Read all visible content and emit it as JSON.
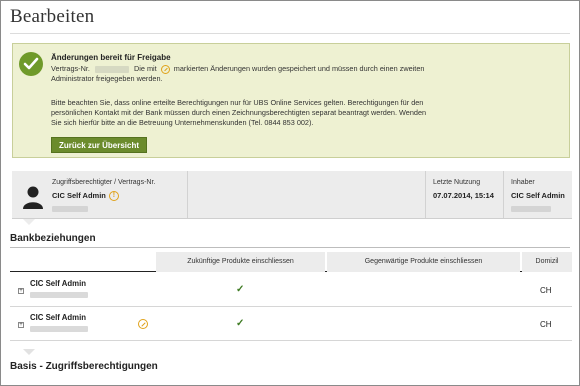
{
  "page": {
    "title": "Bearbeiten"
  },
  "notice": {
    "title": "Änderungen bereit für Freigabe",
    "line1_prefix": "Vertrags-Nr.",
    "line1_middle": "Die mit",
    "line1_suffix": "markierten Änderungen wurden gespeichert und müssen durch einen zweiten",
    "line2": "Administrator freigegeben werden.",
    "line3": "Bitte beachten Sie, dass online erteilte Berechtigungen nur für UBS Online Services gelten. Berechtigungen für den",
    "line4": "persönlichen Kontakt mit der Bank müssen durch einen Zeichnungsberechtigten separat beantragt werden. Wenden",
    "line5": "Sie sich hierfür bitte an die Betreuung Unternehmenskunden (Tel. 0844 853 002).",
    "back_button": "Zurück zur Übersicht",
    "icon": "check-circle-icon",
    "accent_color": "#6b8b2c"
  },
  "user_bar": {
    "label": "Zugriffsberechtigter / Vertrags-Nr.",
    "name": "CIC Self Admin",
    "last_use_label": "Letzte Nutzung",
    "last_use_value": "07.07.2014, 15:14",
    "owner_label": "Inhaber",
    "owner_value": "CIC Self Admin"
  },
  "bank": {
    "title": "Bankbeziehungen",
    "columns": [
      "Zukünftige Produkte einschliessen",
      "Gegenwärtige Produkte einschliessen",
      "Domizil"
    ],
    "rows": [
      {
        "name": "CIC Self Admin",
        "future": "✓",
        "current": "",
        "domicile": "CH",
        "pending": false
      },
      {
        "name": "CIC Self Admin",
        "future": "✓",
        "current": "",
        "domicile": "CH",
        "pending": true
      }
    ]
  },
  "basis": {
    "title": "Basis - Zugriffsberechtigungen"
  }
}
